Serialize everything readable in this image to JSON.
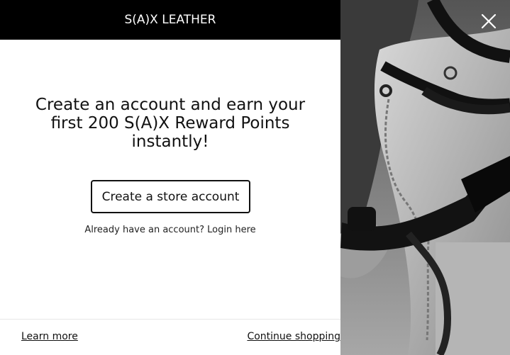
{
  "modal": {
    "brand": "S(A)X LEATHER",
    "headline": "Create an account and earn your first 200 S(A)X Reward Points instantly!",
    "create_account_button": "Create a store account",
    "login_text": "Already have an account? Login here",
    "learn_more_link": "Learn more",
    "continue_shopping_link": "Continue shopping"
  },
  "image": {
    "description": "",
    "icon": "close-icon"
  },
  "colors": {
    "header_bg": "#000000",
    "panel_bg": "#ffffff",
    "text": "#111111"
  }
}
